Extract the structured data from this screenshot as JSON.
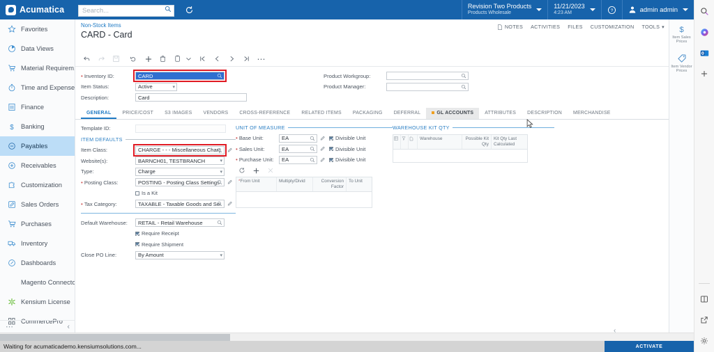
{
  "topbar": {
    "brand": "Acumatica",
    "search_placeholder": "Search...",
    "refresh_icon": "refresh-icon",
    "search_icon": "search-icon",
    "company": {
      "line1": "Revision Two Products",
      "line2": "Products Wholesale"
    },
    "datetime": {
      "line1": "11/21/2023",
      "line2": "4:23 AM"
    },
    "help_icon": "help-icon",
    "user": "admin admin",
    "user_icon": "user-icon"
  },
  "sidebar": {
    "items": [
      {
        "label": "Favorites",
        "icon": "star-icon",
        "active": false
      },
      {
        "label": "Data Views",
        "icon": "pie-chart-icon",
        "active": false
      },
      {
        "label": "Material Requirem...",
        "icon": "cart-icon",
        "active": false
      },
      {
        "label": "Time and Expenses",
        "icon": "stopwatch-icon",
        "active": false
      },
      {
        "label": "Finance",
        "icon": "ledger-icon",
        "active": false
      },
      {
        "label": "Banking",
        "icon": "dollar-icon",
        "active": false
      },
      {
        "label": "Payables",
        "icon": "minus-circle-icon",
        "active": true
      },
      {
        "label": "Receivables",
        "icon": "plus-circle-icon",
        "active": false
      },
      {
        "label": "Customization",
        "icon": "puzzle-icon",
        "active": false
      },
      {
        "label": "Sales Orders",
        "icon": "pencil-square-icon",
        "active": false
      },
      {
        "label": "Purchases",
        "icon": "shopping-cart-icon",
        "active": false
      },
      {
        "label": "Inventory",
        "icon": "truck-icon",
        "active": false
      },
      {
        "label": "Dashboards",
        "icon": "gauge-icon",
        "active": false
      },
      {
        "label": "Magento Connector",
        "icon": "none",
        "active": false
      },
      {
        "label": "Kensium License",
        "icon": "asterisk-icon",
        "active": false
      },
      {
        "label": "CommercePro",
        "icon": "blocks-icon",
        "active": false
      }
    ],
    "more_icon": "ellipsis-icon",
    "collapse_icon": "chevron-left-icon"
  },
  "page": {
    "breadcrumb": "Non-Stock Items",
    "title": "CARD - Card",
    "head_links": [
      {
        "label": "NOTES",
        "icon": "note-icon"
      },
      {
        "label": "ACTIVITIES",
        "icon": "none"
      },
      {
        "label": "FILES",
        "icon": "none"
      },
      {
        "label": "CUSTOMIZATION",
        "icon": "none"
      },
      {
        "label": "TOOLS",
        "icon": "caret-down-icon"
      }
    ],
    "toolbar": [
      {
        "name": "back-button",
        "glyph": "↩",
        "disabled": false
      },
      {
        "name": "forward-button",
        "glyph": "↪",
        "disabled": true
      },
      {
        "name": "save-button",
        "glyph": "⌸",
        "disabled": true
      },
      {
        "name": "undo-button",
        "glyph": "↶",
        "disabled": false
      },
      {
        "name": "add-new-record-button",
        "glyph": "＋",
        "disabled": false
      },
      {
        "name": "delete-record-button",
        "glyph": "Ὕ1",
        "disabled": false
      },
      {
        "name": "copy-paste-button",
        "glyph": "❐",
        "disabled": false
      },
      {
        "name": "copy-paste-dropdown",
        "glyph": "⌄",
        "disabled": false
      },
      {
        "name": "first-record-button",
        "glyph": "⏮",
        "disabled": false
      },
      {
        "name": "previous-record-button",
        "glyph": "‹",
        "disabled": false
      },
      {
        "name": "next-record-button",
        "glyph": "›",
        "disabled": false
      },
      {
        "name": "last-record-button",
        "glyph": "⏭",
        "disabled": false
      },
      {
        "name": "more-actions-button",
        "glyph": "⋯",
        "disabled": false
      }
    ]
  },
  "summary": {
    "inventory_id": {
      "label": "Inventory ID:",
      "value": "CARD",
      "required": true,
      "selected": true,
      "highlighted": true
    },
    "item_status": {
      "label": "Item Status:",
      "value": "Active"
    },
    "description": {
      "label": "Description:",
      "value": "Card"
    },
    "product_workgroup": {
      "label": "Product Workgroup:",
      "value": ""
    },
    "product_manager": {
      "label": "Product Manager:",
      "value": ""
    }
  },
  "tabs": [
    {
      "label": "GENERAL",
      "active": true,
      "highlighted": false,
      "dot": false
    },
    {
      "label": "PRICE/COST",
      "active": false,
      "highlighted": false,
      "dot": false
    },
    {
      "label": "S3 IMAGES",
      "active": false,
      "highlighted": false,
      "dot": false
    },
    {
      "label": "VENDORS",
      "active": false,
      "highlighted": false,
      "dot": false
    },
    {
      "label": "CROSS-REFERENCE",
      "active": false,
      "highlighted": false,
      "dot": false
    },
    {
      "label": "RELATED ITEMS",
      "active": false,
      "highlighted": false,
      "dot": false
    },
    {
      "label": "PACKAGING",
      "active": false,
      "highlighted": false,
      "dot": false
    },
    {
      "label": "DEFERRAL",
      "active": false,
      "highlighted": false,
      "dot": false
    },
    {
      "label": "GL ACCOUNTS",
      "active": false,
      "highlighted": true,
      "dot": true
    },
    {
      "label": "ATTRIBUTES",
      "active": false,
      "highlighted": false,
      "dot": false
    },
    {
      "label": "DESCRIPTION",
      "active": false,
      "highlighted": false,
      "dot": false
    },
    {
      "label": "MERCHANDISE",
      "active": false,
      "highlighted": false,
      "dot": false
    }
  ],
  "general": {
    "template_id": {
      "label": "Template ID:",
      "value": ""
    },
    "item_defaults_header": "ITEM DEFAULTS",
    "item_class": {
      "label": "Item Class:",
      "value": "CHARGE   -  - - Miscellaneous Charg",
      "highlighted": true
    },
    "websites": {
      "label": "Website(s):",
      "value": "BARNCH01, TESTBRANCH"
    },
    "type": {
      "label": "Type:",
      "value": "Charge"
    },
    "posting_class": {
      "label": "Posting Class:",
      "value": "POSTING - Posting Class Settings",
      "required": true
    },
    "is_a_kit": {
      "label": "Is a Kit",
      "checked": false
    },
    "tax_category": {
      "label": "Tax Category:",
      "value": "TAXABLE - Taxable Goods and Servic",
      "required": true
    },
    "default_warehouse": {
      "label": "Default Warehouse:",
      "value": "RETAIL - Retail Warehouse"
    },
    "require_receipt": {
      "label": "Require Receipt",
      "checked": true
    },
    "require_shipment": {
      "label": "Require Shipment",
      "checked": true
    },
    "close_po_line": {
      "label": "Close PO Line:",
      "value": "By Amount"
    }
  },
  "unit_of_measure": {
    "header": "UNIT OF MEASURE",
    "base_unit": {
      "label": "Base Unit:",
      "value": "EA",
      "required": true,
      "divisible_label": "Divisible Unit",
      "divisible": true
    },
    "sales_unit": {
      "label": "Sales Unit:",
      "value": "EA",
      "required": true,
      "divisible_label": "Divisible Unit",
      "divisible": true
    },
    "purchase_unit": {
      "label": "Purchase Unit:",
      "value": "EA",
      "required": true,
      "divisible_label": "Divisible Unit",
      "divisible": true
    },
    "grid_tools": [
      {
        "name": "refresh-grid-button",
        "glyph": "⟳",
        "disabled": false
      },
      {
        "name": "add-row-button",
        "glyph": "＋",
        "disabled": false
      },
      {
        "name": "delete-row-button",
        "glyph": "✕",
        "disabled": true
      }
    ],
    "columns": [
      "From Unit",
      "Multiply/Divid",
      "Conversion Factor",
      "To Unit"
    ],
    "rows": []
  },
  "warehouse_kit_qty": {
    "header": "WAREHOUSE KIT QTY",
    "columns": [
      "Warehouse",
      "Possible Kit Qty",
      "Kit Qty Last Calculated"
    ],
    "icon_columns": [
      "grid-icon",
      "filter-icon",
      "file-icon"
    ],
    "rows": []
  },
  "right_panel": {
    "items": [
      {
        "label": "Item Sales Prices",
        "icon": "dollar-icon"
      },
      {
        "label": "Item Vendor Prices",
        "icon": "tag-icon"
      }
    ]
  },
  "browser_sidebar": {
    "items": [
      {
        "name": "search-icon"
      },
      {
        "name": "copilot-icon"
      },
      {
        "name": "outlook-icon"
      },
      {
        "name": "add-tool-icon"
      }
    ],
    "bottom_items": [
      {
        "name": "split-screen-icon"
      },
      {
        "name": "open-external-icon"
      },
      {
        "name": "settings-gear-icon"
      }
    ]
  },
  "status_bar": {
    "text": "Waiting for acumaticademo.kensiumsolutions.com...",
    "activate_label": "ACTIVATE"
  },
  "colors": {
    "brand_blue": "#1763ab",
    "accent_link": "#1f7ac4",
    "highlight_red": "#e01b24",
    "selection_blue": "#2f6fd0",
    "tab_dot_orange": "#f0a020",
    "active_nav": "#bcddf7"
  }
}
